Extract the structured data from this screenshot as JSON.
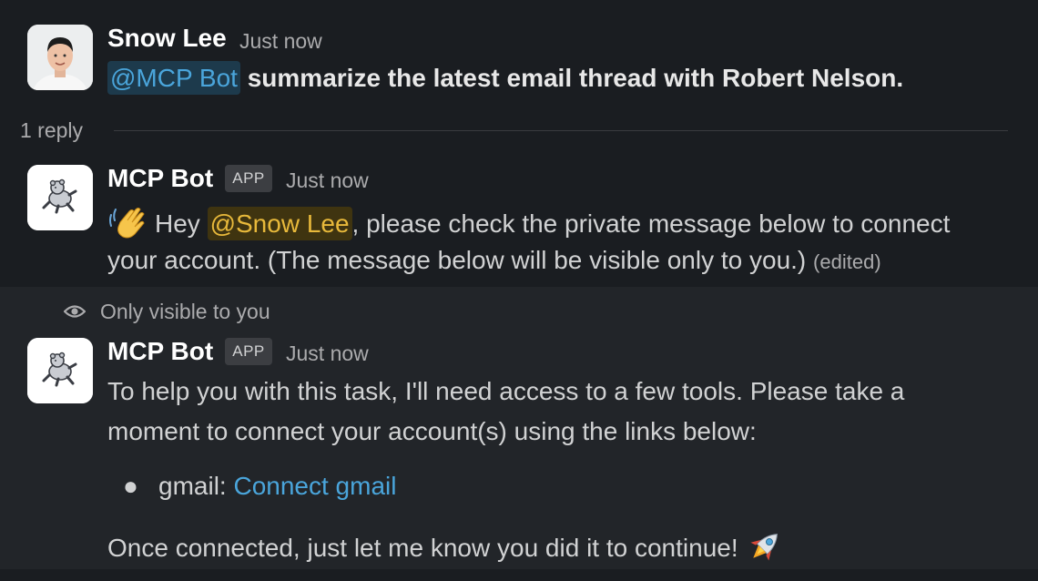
{
  "thread": {
    "parent": {
      "author": "Snow Lee",
      "time": "Just now",
      "mention": "@MCP Bot",
      "text": "summarize the latest email thread with Robert Nelson."
    },
    "reply_count": "1 reply",
    "reply1": {
      "author": "MCP Bot",
      "badge": "APP",
      "time": "Just now",
      "greeting": "Hey",
      "mention": "@Snow Lee",
      "text_part1": ", please check the private message below to connect",
      "text_part2": "your account. (The message below will be visible only to you.)",
      "edited": "(edited)"
    },
    "ephemeral": {
      "notice": "Only visible to you",
      "author": "MCP Bot",
      "badge": "APP",
      "time": "Just now",
      "line1": "To help you with this task, I'll need access to a few tools. Please take a",
      "line2": "moment to connect your account(s) using the links below:",
      "bullet_label": "gmail:",
      "bullet_link": "Connect gmail",
      "closing": "Once connected, just let me know you did it to continue!"
    }
  },
  "colors": {
    "background": "#1a1d21",
    "ephemeral_background": "#222529",
    "mention": "#4aa5db",
    "self_mention": "#e8b93b",
    "link": "#4aa5db"
  },
  "icons": {
    "user_avatar": "person-photo-avatar",
    "bot_avatar": "running-bear-avatar",
    "wave": "waving-hand-emoji",
    "rocket": "rocket-emoji",
    "eye": "eye-icon"
  }
}
